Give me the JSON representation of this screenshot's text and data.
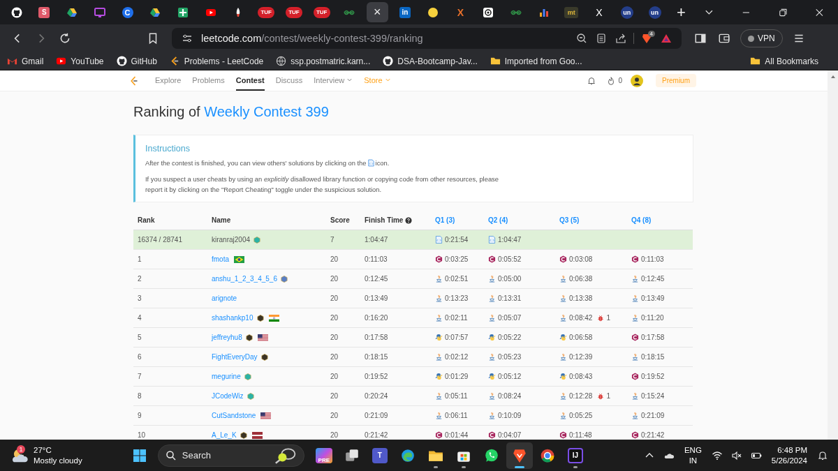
{
  "browser": {
    "tabs": [
      {
        "kind": "github",
        "selected": false
      },
      {
        "kind": "letter-red",
        "text": "S",
        "selected": false
      },
      {
        "kind": "drive",
        "selected": false
      },
      {
        "kind": "screen",
        "selected": false
      },
      {
        "kind": "circle-blue",
        "text": "C",
        "selected": false
      },
      {
        "kind": "drive",
        "selected": false
      },
      {
        "kind": "sheets",
        "selected": false
      },
      {
        "kind": "youtube",
        "selected": false
      },
      {
        "kind": "rocket",
        "selected": false
      },
      {
        "kind": "tuf",
        "text": "TUF",
        "selected": false
      },
      {
        "kind": "tuf",
        "text": "TUF",
        "selected": false
      },
      {
        "kind": "tuf",
        "text": "TUF",
        "selected": false
      },
      {
        "kind": "gfg",
        "selected": false
      },
      {
        "kind": "close",
        "text": "×",
        "selected": true
      },
      {
        "kind": "linkedin",
        "text": "in",
        "selected": false
      },
      {
        "kind": "dot",
        "selected": false
      },
      {
        "kind": "x-orange",
        "text": "X",
        "selected": false
      },
      {
        "kind": "openai",
        "selected": false
      },
      {
        "kind": "gfg",
        "selected": false
      },
      {
        "kind": "chart",
        "selected": false
      },
      {
        "kind": "mt",
        "text": "mt",
        "selected": false
      },
      {
        "kind": "x",
        "text": "X",
        "selected": false
      },
      {
        "kind": "un",
        "text": "un",
        "selected": false
      },
      {
        "kind": "un",
        "text": "un",
        "selected": false
      }
    ],
    "new_tab": "+",
    "address": {
      "host": "leetcode.com",
      "path": "/contest/weekly-contest-399/ranking",
      "shield_count": "4"
    },
    "vpn": "VPN",
    "bookmarks": [
      {
        "kind": "gmail",
        "label": "Gmail"
      },
      {
        "kind": "youtube",
        "label": "YouTube"
      },
      {
        "kind": "github",
        "label": "GitHub"
      },
      {
        "kind": "leetcode",
        "label": "Problems - LeetCode"
      },
      {
        "kind": "globe",
        "label": "ssp.postmatric.karn..."
      },
      {
        "kind": "github",
        "label": "DSA-Bootcamp-Jav..."
      },
      {
        "kind": "folder",
        "label": "Imported from Goo..."
      }
    ],
    "all_bookmarks": "All Bookmarks"
  },
  "nav": {
    "items": [
      {
        "label": "Explore",
        "selected": false,
        "dropdown": false,
        "accent": false
      },
      {
        "label": "Problems",
        "selected": false,
        "dropdown": false,
        "accent": false
      },
      {
        "label": "Contest",
        "selected": true,
        "dropdown": false,
        "accent": false
      },
      {
        "label": "Discuss",
        "selected": false,
        "dropdown": false,
        "accent": false
      },
      {
        "label": "Interview",
        "selected": false,
        "dropdown": true,
        "accent": false
      },
      {
        "label": "Store",
        "selected": false,
        "dropdown": true,
        "accent": true
      }
    ],
    "streak": "0",
    "premium": "Premium"
  },
  "title": {
    "prefix": "Ranking of",
    "contest": "Weekly Contest 399"
  },
  "instructions": {
    "title": "Instructions",
    "line_before_icon": "After the contest is finished, you can view others' solutions by clicking on the",
    "line_after_icon": "icon.",
    "paragraph": "If you suspect a user cheats by using an *explicitly* disallowed library function or copying code from other resources, please report it by clicking on the \"Report Cheating\" toggle under the suspicious solution."
  },
  "table": {
    "columns": [
      {
        "label": "Rank",
        "kind": "plain"
      },
      {
        "label": "Name",
        "kind": "plain"
      },
      {
        "label": "Score",
        "kind": "plain"
      },
      {
        "label": "Finish Time",
        "kind": "help"
      },
      {
        "label": "Q1 (3)",
        "kind": "link"
      },
      {
        "label": "Q2 (4)",
        "kind": "link"
      },
      {
        "label": "Q3 (5)",
        "kind": "link"
      },
      {
        "label": "Q4 (8)",
        "kind": "link"
      }
    ],
    "rows": [
      {
        "rank": "16374 / 28741",
        "name": "kiranraj2004",
        "own": true,
        "marks": [
          {
            "kind": "knight"
          }
        ],
        "score": "7",
        "finish": "1:04:47",
        "subs": [
          {
            "kind": "file",
            "time": "0:21:54"
          },
          {
            "kind": "file",
            "time": "1:04:47"
          }
        ]
      },
      {
        "rank": "1",
        "name": "fmota",
        "own": false,
        "marks": [
          {
            "kind": "brazil"
          }
        ],
        "score": "20",
        "finish": "0:11:03",
        "subs": [
          {
            "kind": "cpp",
            "time": "0:03:25"
          },
          {
            "kind": "cpp",
            "time": "0:05:52"
          },
          {
            "kind": "cpp",
            "time": "0:03:08"
          },
          {
            "kind": "cpp",
            "time": "0:11:03"
          }
        ]
      },
      {
        "rank": "2",
        "name": "anshu_1_2_3_4_5_6",
        "own": false,
        "marks": [
          {
            "kind": "blue"
          }
        ],
        "score": "20",
        "finish": "0:12:45",
        "subs": [
          {
            "kind": "java",
            "time": "0:02:51"
          },
          {
            "kind": "java",
            "time": "0:05:00"
          },
          {
            "kind": "java",
            "time": "0:06:38"
          },
          {
            "kind": "java",
            "time": "0:12:45"
          }
        ]
      },
      {
        "rank": "3",
        "name": "arignote",
        "own": false,
        "marks": [],
        "score": "20",
        "finish": "0:13:49",
        "subs": [
          {
            "kind": "java",
            "time": "0:13:23"
          },
          {
            "kind": "java",
            "time": "0:13:31"
          },
          {
            "kind": "java",
            "time": "0:13:38"
          },
          {
            "kind": "java",
            "time": "0:13:49"
          }
        ]
      },
      {
        "rank": "4",
        "name": "shashankp10",
        "own": false,
        "marks": [
          {
            "kind": "guardian"
          },
          {
            "kind": "india"
          }
        ],
        "score": "20",
        "finish": "0:16:20",
        "subs": [
          {
            "kind": "java",
            "time": "0:02:11"
          },
          {
            "kind": "java",
            "time": "0:05:07"
          },
          {
            "kind": "java",
            "time": "0:08:42",
            "bugs": "1"
          },
          {
            "kind": "java",
            "time": "0:11:20"
          }
        ]
      },
      {
        "rank": "5",
        "name": "jeffreyhu8",
        "own": false,
        "marks": [
          {
            "kind": "guardian"
          },
          {
            "kind": "usa"
          }
        ],
        "score": "20",
        "finish": "0:17:58",
        "subs": [
          {
            "kind": "python",
            "time": "0:07:57"
          },
          {
            "kind": "python",
            "time": "0:05:22"
          },
          {
            "kind": "python",
            "time": "0:06:58"
          },
          {
            "kind": "cpp",
            "time": "0:17:58"
          }
        ]
      },
      {
        "rank": "6",
        "name": "FightEveryDay",
        "own": false,
        "marks": [
          {
            "kind": "guardian"
          }
        ],
        "score": "20",
        "finish": "0:18:15",
        "subs": [
          {
            "kind": "java",
            "time": "0:02:12"
          },
          {
            "kind": "java",
            "time": "0:05:23"
          },
          {
            "kind": "java",
            "time": "0:12:39"
          },
          {
            "kind": "java",
            "time": "0:18:15"
          }
        ]
      },
      {
        "rank": "7",
        "name": "megurine",
        "own": false,
        "marks": [
          {
            "kind": "knight"
          }
        ],
        "score": "20",
        "finish": "0:19:52",
        "subs": [
          {
            "kind": "python",
            "time": "0:01:29"
          },
          {
            "kind": "python",
            "time": "0:05:12"
          },
          {
            "kind": "python",
            "time": "0:08:43"
          },
          {
            "kind": "cpp",
            "time": "0:19:52"
          }
        ]
      },
      {
        "rank": "8",
        "name": "JCodeWiz",
        "own": false,
        "marks": [
          {
            "kind": "knight"
          }
        ],
        "score": "20",
        "finish": "0:20:24",
        "subs": [
          {
            "kind": "java",
            "time": "0:05:11"
          },
          {
            "kind": "java",
            "time": "0:08:24"
          },
          {
            "kind": "java",
            "time": "0:12:28",
            "bugs": "1"
          },
          {
            "kind": "java",
            "time": "0:15:24"
          }
        ]
      },
      {
        "rank": "9",
        "name": "CutSandstone",
        "own": false,
        "marks": [
          {
            "kind": "usa"
          }
        ],
        "score": "20",
        "finish": "0:21:09",
        "subs": [
          {
            "kind": "java",
            "time": "0:06:11"
          },
          {
            "kind": "java",
            "time": "0:10:09"
          },
          {
            "kind": "java",
            "time": "0:05:25"
          },
          {
            "kind": "java",
            "time": "0:21:09"
          }
        ]
      },
      {
        "rank": "10",
        "name": "A_Le_K",
        "own": false,
        "marks": [
          {
            "kind": "guardian"
          },
          {
            "kind": "latvia"
          }
        ],
        "score": "20",
        "finish": "0:21:42",
        "subs": [
          {
            "kind": "cpp",
            "time": "0:01:44"
          },
          {
            "kind": "cpp",
            "time": "0:04:07"
          },
          {
            "kind": "cpp",
            "time": "0:11:48"
          },
          {
            "kind": "cpp",
            "time": "0:21:42"
          }
        ]
      }
    ]
  },
  "taskbar": {
    "weather": {
      "badge": "1",
      "temp": "27°C",
      "condition": "Mostly cloudy"
    },
    "search": {
      "placeholder": "Search"
    },
    "apps": [
      {
        "kind": "copilot",
        "text": "PRE",
        "selected": false,
        "running": false
      },
      {
        "kind": "taskview",
        "selected": false,
        "running": false
      },
      {
        "kind": "teams",
        "text": "T",
        "selected": false,
        "running": false
      },
      {
        "kind": "edge",
        "selected": false,
        "running": false
      },
      {
        "kind": "explorer",
        "selected": false,
        "running": true
      },
      {
        "kind": "store",
        "selected": false,
        "running": true
      },
      {
        "kind": "whatsapp",
        "selected": false,
        "running": false
      },
      {
        "kind": "brave",
        "selected": true,
        "running": true
      },
      {
        "kind": "chrome",
        "selected": false,
        "running": false
      },
      {
        "kind": "intellij",
        "text": "IJ",
        "selected": false,
        "running": true
      }
    ],
    "language": "ENG",
    "region": "IN",
    "time": "6:48 PM",
    "date": "5/26/2024"
  }
}
